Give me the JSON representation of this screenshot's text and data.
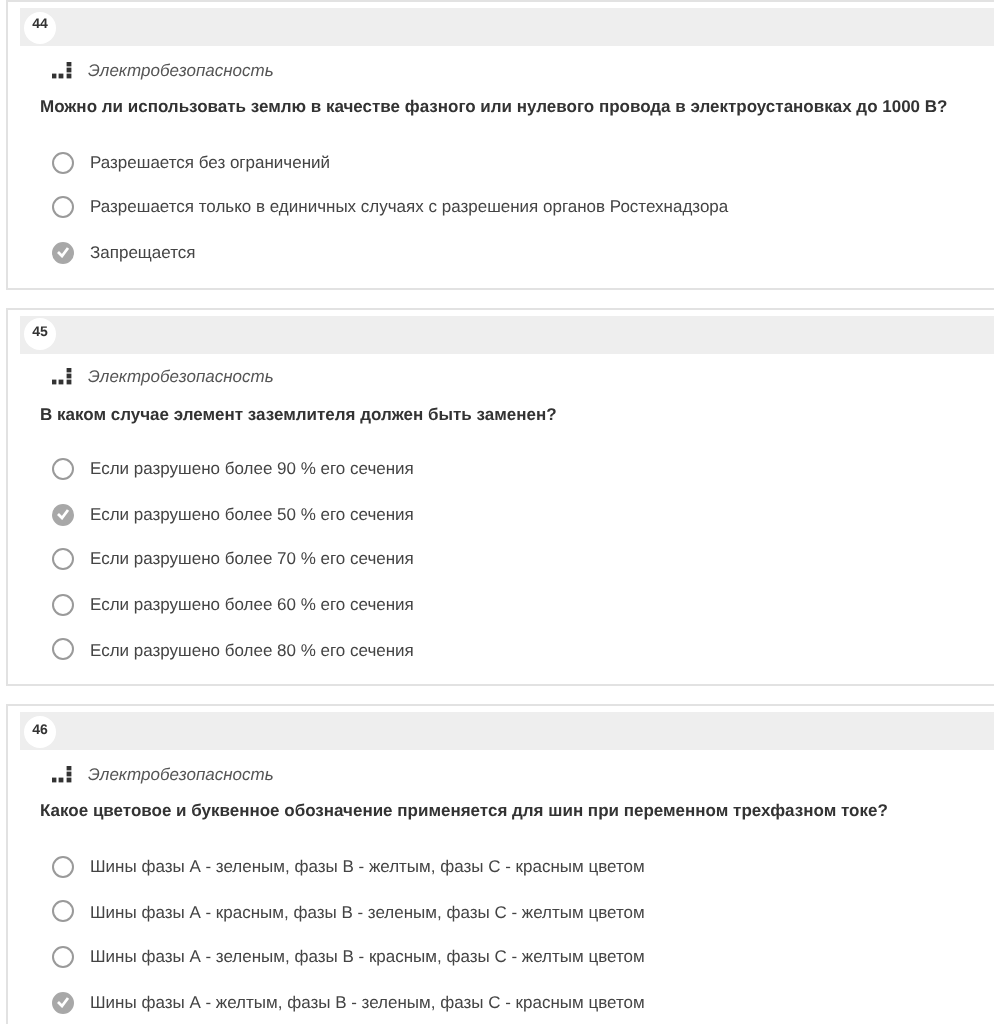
{
  "questions": [
    {
      "number": "44",
      "category": "Электробезопасность",
      "text": "Можно ли использовать землю в качестве фазного или нулевого провода в электроустановках до 1000 В?",
      "options": [
        {
          "label": "Разрешается без ограничений",
          "selected": false
        },
        {
          "label": "Разрешается только в единичных случаях с разрешения органов Ростехнадзора",
          "selected": false
        },
        {
          "label": "Запрещается",
          "selected": true
        }
      ]
    },
    {
      "number": "45",
      "category": "Электробезопасность",
      "text": "В каком случае элемент заземлителя должен быть заменен?",
      "options": [
        {
          "label": "Если разрушено более 90 % его сечения",
          "selected": false
        },
        {
          "label": "Если разрушено более 50 % его сечения",
          "selected": true
        },
        {
          "label": "Если разрушено более 70 % его сечения",
          "selected": false
        },
        {
          "label": "Если разрушено более 60 % его сечения",
          "selected": false
        },
        {
          "label": "Если разрушено более 80 % его сечения",
          "selected": false
        }
      ]
    },
    {
      "number": "46",
      "category": "Электробезопасность",
      "text": "Какое цветовое и буквенное обозначение применяется для шин при переменном трехфазном токе?",
      "options": [
        {
          "label": "Шины фазы А - зеленым, фазы В - желтым, фазы С - красным цветом",
          "selected": false
        },
        {
          "label": "Шины фазы А - красным, фазы В - зеленым, фазы С - желтым цветом",
          "selected": false
        },
        {
          "label": "Шины фазы А - зеленым, фазы В - красным, фазы С - желтым цветом",
          "selected": false
        },
        {
          "label": "Шины фазы А - желтым, фазы В - зеленым, фазы С - красным цветом",
          "selected": true
        }
      ]
    }
  ]
}
